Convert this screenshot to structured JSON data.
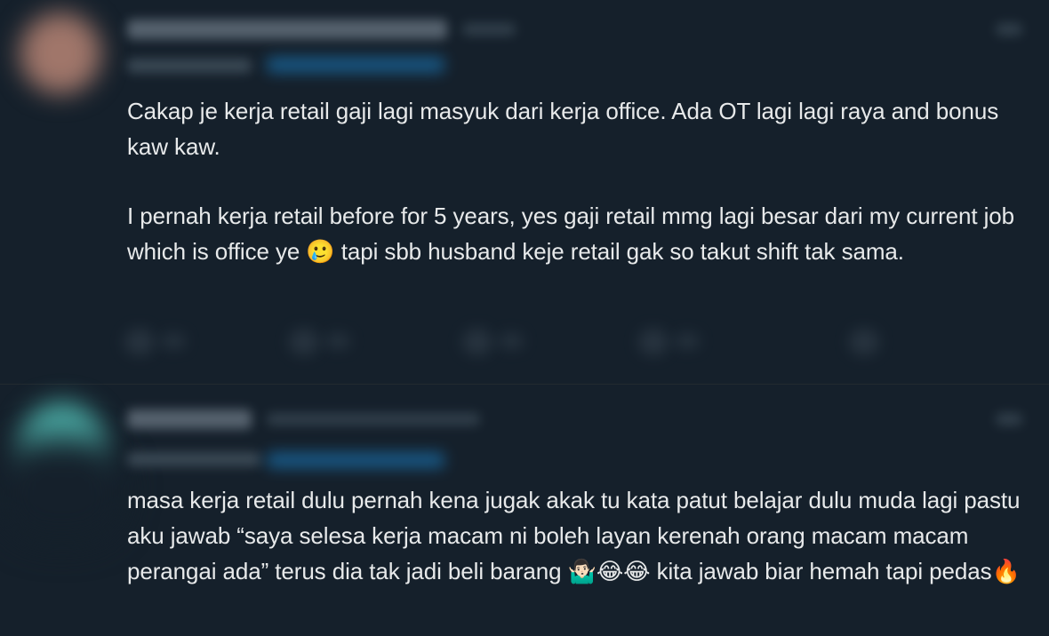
{
  "tweet1": {
    "paragraphs": [
      "Cakap je kerja retail gaji lagi masyuk dari kerja office. Ada OT lagi lagi raya and bonus kaw kaw.",
      "I pernah kerja retail before for 5 years, yes gaji retail mmg lagi besar dari my current job which is office ye 🥲 tapi sbb husband keje retail gak so takut shift tak sama."
    ]
  },
  "tweet2": {
    "paragraphs": [
      "masa kerja retail dulu pernah kena jugak akak tu kata patut belajar dulu muda lagi pastu aku jawab “saya selesa kerja macam ni boleh layan kerenah orang macam macam perangai ada” terus dia tak jadi beli barang 🤷🏻‍♂️😂😂 kita jawab biar hemah tapi pedas🔥"
    ]
  },
  "colors": {
    "background": "#15202b",
    "text": "#e7e9ea",
    "accent": "#1d9bf0",
    "muted": "#536471"
  },
  "icons": {
    "tweet1_actions": [
      "reply-icon",
      "retweet-icon",
      "like-icon",
      "views-icon",
      "share-icon"
    ],
    "more": "more-icon"
  }
}
